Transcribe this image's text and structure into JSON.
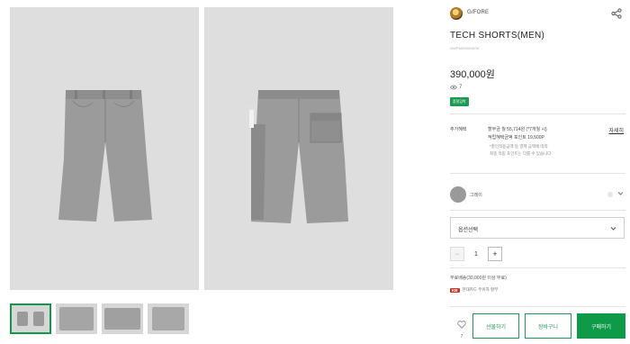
{
  "gallery": {
    "photo_count": 2,
    "thumbnails": [
      {
        "label": "front-back combined",
        "active": true
      },
      {
        "label": "detail 1",
        "active": false
      },
      {
        "label": "detail 2",
        "active": false
      },
      {
        "label": "detail 3",
        "active": false
      }
    ]
  },
  "brand": {
    "name": "G/FORE"
  },
  "product": {
    "title": "TECH SHORTS(MEN)",
    "code": "GMPN00000000",
    "price": "390,000원",
    "views": "7",
    "badge": "품절임박"
  },
  "benefits": {
    "label": "추가혜택",
    "line1": "할부금 월 55,714원 (*7개월 시)",
    "line2": "적립혜택금액 포인트 19,500P",
    "note1": "*할인적용금액 등 결제 금액에 따라",
    "note2": "최종 적립 포인트는 다를 수 있습니다.",
    "detail_link": "자세히"
  },
  "color": {
    "name": "그레이"
  },
  "option_select": {
    "placeholder": "옵션선택"
  },
  "quantity": {
    "value": "1",
    "minus": "−",
    "plus": "+"
  },
  "shipping": {
    "text": "무료배송(30,000원 이상 무료)"
  },
  "card": {
    "logo": "KB",
    "text": "현대카드 무이자 할부"
  },
  "actions": {
    "like_count": "7",
    "gift": "선물하기",
    "cart": "장바구니",
    "buy": "구매하기"
  },
  "colors": {
    "accent": "#0e9a48",
    "product_grey": "#9a9a9a",
    "photo_bg": "#dedede"
  }
}
